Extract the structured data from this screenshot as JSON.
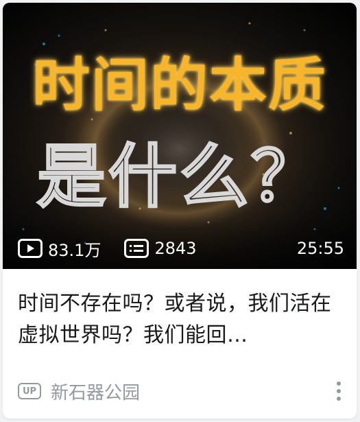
{
  "thumbnail": {
    "headline": "时间的本质",
    "subheadline": "是什么？",
    "icons": {
      "views": "play-icon",
      "danmaku": "danmaku-icon"
    }
  },
  "stats": {
    "views": "83.1万",
    "danmaku": "2843",
    "duration": "25:55"
  },
  "video": {
    "title": "时间不存在吗？或者说，我们活在虚拟世界吗？我们能回…"
  },
  "author": {
    "badge": "UP",
    "name": "新石器公园",
    "more_icon": "more-vertical-icon"
  },
  "colors": {
    "headline": "#f6b52a",
    "meta_gray": "#9499a0",
    "title_text": "#18191c"
  }
}
